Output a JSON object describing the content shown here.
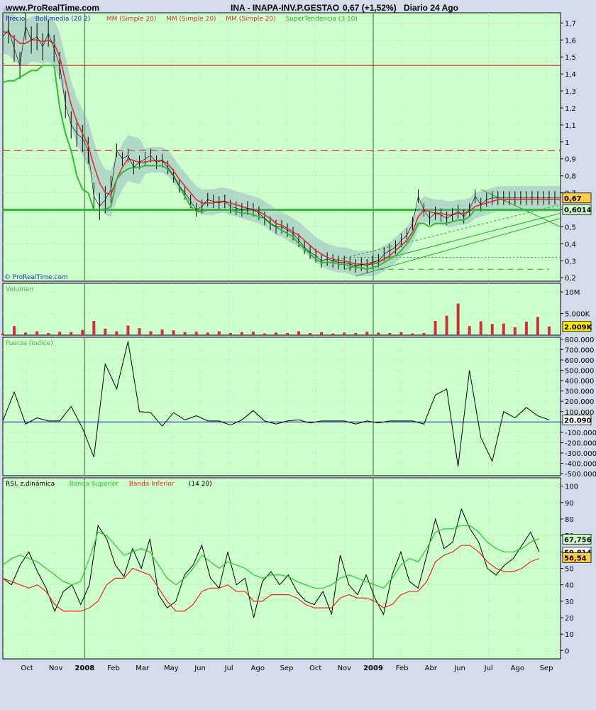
{
  "header": {
    "site": "www.ProRealTime.com",
    "title": "INA - INAPA-INV.P.GESTAO",
    "quote": "0,67 (+1,52%)",
    "period": "Diario  24 Ago"
  },
  "watermark": "© ProRealTime.com",
  "colors": {
    "bg": "#ccffcc",
    "price": "#000000",
    "mm": "#e03030",
    "boll": "#8090c0",
    "supertrend": "#33bb33",
    "vol": "#cc3333",
    "rsi_upper": "#22cc22",
    "rsi_lower": "#ee2222"
  },
  "chart_data": [
    {
      "type": "line",
      "name": "price-panel",
      "legend": [
        "Precio",
        "Boll media (20 2)",
        "MM (Simple 20)",
        "MM (Simple 20)",
        "MM (Simple 20)",
        "SuperTendencia (3 10)"
      ],
      "legend_colors": [
        "#2222cc",
        "#2222cc",
        "#cc3333",
        "#cc3333",
        "#cc3333",
        "#33aa33"
      ],
      "ylim": [
        0.18,
        1.76
      ],
      "yticks": [
        "1,7",
        "1,6",
        "1,5",
        "1,4",
        "1,3",
        "1,2",
        "1,1",
        "1",
        "0,9",
        "0,8",
        "0,7",
        "0,6",
        "0,5",
        "0,4",
        "0,3",
        "0,2"
      ],
      "ytick_values": [
        1.7,
        1.6,
        1.5,
        1.4,
        1.3,
        1.2,
        1.1,
        1.0,
        0.9,
        0.8,
        0.7,
        0.6,
        0.5,
        0.4,
        0.3,
        0.2
      ],
      "markers": [
        {
          "text": "0,67",
          "value": 0.67,
          "style": "orange"
        },
        {
          "text": "0,6014",
          "value": 0.6014,
          "style": "green"
        }
      ],
      "hlines": [
        {
          "y": 1.45,
          "color": "#dd2222",
          "dash": ""
        },
        {
          "y": 0.95,
          "color": "#dd2222",
          "dash": "10,6"
        },
        {
          "y": 0.6,
          "color": "#33bb33",
          "dash": "",
          "width": 3
        }
      ],
      "x": [
        0,
        5,
        10,
        15,
        20,
        25,
        30,
        35,
        40,
        45,
        50,
        55,
        60,
        65,
        70,
        75,
        80,
        85,
        90,
        95,
        100,
        105,
        110,
        115,
        120,
        125,
        130,
        135,
        140,
        145,
        150,
        155,
        160,
        165,
        170,
        175,
        180,
        185,
        190,
        195,
        200,
        205,
        210,
        215,
        220,
        225,
        230,
        235,
        240,
        245,
        250,
        255,
        260,
        265,
        270,
        275,
        280,
        285,
        290,
        295,
        300,
        305,
        310,
        315,
        320,
        325,
        330,
        335,
        340,
        345,
        350,
        355,
        360,
        365,
        370,
        375,
        380,
        385,
        390,
        395,
        400,
        405,
        410,
        415,
        420,
        425,
        430,
        435,
        440,
        445,
        450,
        455,
        460,
        465,
        470,
        475,
        480,
        485,
        490
      ],
      "series": [
        {
          "name": "Precio",
          "values": [
            1.62,
            1.66,
            1.55,
            1.45,
            1.68,
            1.6,
            1.62,
            1.56,
            1.64,
            1.55,
            1.45,
            1.22,
            1.1,
            1.05,
            1.02,
            0.95,
            0.68,
            0.62,
            0.66,
            0.72,
            0.95,
            0.9,
            0.92,
            0.85,
            0.88,
            0.9,
            0.92,
            0.88,
            0.89,
            0.85,
            0.8,
            0.74,
            0.7,
            0.65,
            0.6,
            0.62,
            0.66,
            0.65,
            0.64,
            0.65,
            0.62,
            0.61,
            0.6,
            0.61,
            0.6,
            0.58,
            0.55,
            0.52,
            0.5,
            0.5,
            0.48,
            0.46,
            0.42,
            0.38,
            0.35,
            0.33,
            0.3,
            0.31,
            0.3,
            0.29,
            0.29,
            0.28,
            0.27,
            0.28,
            0.27,
            0.29,
            0.3,
            0.34,
            0.36,
            0.38,
            0.42,
            0.45,
            0.52,
            0.68,
            0.6,
            0.55,
            0.58,
            0.57,
            0.55,
            0.57,
            0.59,
            0.56,
            0.6,
            0.68,
            0.63,
            0.66,
            0.67,
            0.67,
            0.67,
            0.67,
            0.67,
            0.67,
            0.67,
            0.67,
            0.67,
            0.67,
            0.67,
            0.67,
            0.67
          ]
        },
        {
          "name": "MM (Simple 20)",
          "values": [
            1.65,
            1.64,
            1.61,
            1.58,
            1.58,
            1.6,
            1.6,
            1.59,
            1.6,
            1.58,
            1.5,
            1.36,
            1.22,
            1.12,
            1.05,
            0.98,
            0.86,
            0.76,
            0.7,
            0.69,
            0.78,
            0.85,
            0.9,
            0.89,
            0.88,
            0.88,
            0.89,
            0.89,
            0.89,
            0.87,
            0.83,
            0.78,
            0.74,
            0.7,
            0.66,
            0.64,
            0.64,
            0.64,
            0.65,
            0.65,
            0.64,
            0.63,
            0.62,
            0.61,
            0.6,
            0.59,
            0.57,
            0.55,
            0.52,
            0.51,
            0.49,
            0.47,
            0.45,
            0.42,
            0.39,
            0.36,
            0.34,
            0.32,
            0.31,
            0.3,
            0.3,
            0.29,
            0.28,
            0.28,
            0.28,
            0.28,
            0.29,
            0.31,
            0.33,
            0.36,
            0.39,
            0.42,
            0.47,
            0.56,
            0.6,
            0.59,
            0.58,
            0.58,
            0.57,
            0.57,
            0.58,
            0.58,
            0.59,
            0.62,
            0.63,
            0.64,
            0.65,
            0.66,
            0.66,
            0.66,
            0.66,
            0.66,
            0.66,
            0.66,
            0.66,
            0.66,
            0.66,
            0.66,
            0.66
          ]
        },
        {
          "name": "SuperTendencia (3 10)",
          "values": [
            1.35,
            1.36,
            1.36,
            1.38,
            1.4,
            1.42,
            1.42,
            1.45,
            1.45,
            1.45,
            1.2,
            1.05,
            0.95,
            0.8,
            0.72,
            0.7,
            0.6,
            0.6,
            0.6,
            0.62,
            0.78,
            0.82,
            0.84,
            0.85,
            0.85,
            0.86,
            0.86,
            0.86,
            0.86,
            0.84,
            0.8,
            0.74,
            0.68,
            0.62,
            0.59,
            0.59,
            0.6,
            0.6,
            0.6,
            0.6,
            0.6,
            0.59,
            0.58,
            0.58,
            0.57,
            0.56,
            0.55,
            0.52,
            0.5,
            0.48,
            0.46,
            0.44,
            0.4,
            0.37,
            0.34,
            0.31,
            0.29,
            0.29,
            0.29,
            0.28,
            0.28,
            0.27,
            0.26,
            0.26,
            0.25,
            0.26,
            0.27,
            0.29,
            0.31,
            0.33,
            0.36,
            0.4,
            0.45,
            0.52,
            0.52,
            0.5,
            0.52,
            0.52,
            0.52,
            0.53,
            0.54,
            0.54,
            0.56,
            0.6,
            0.6,
            0.6,
            0.6,
            0.6,
            0.6,
            0.6,
            0.6,
            0.6,
            0.6,
            0.6,
            0.6,
            0.6,
            0.6,
            0.6,
            0.6
          ]
        }
      ]
    },
    {
      "type": "bar",
      "name": "volume-panel",
      "legend": [
        "Volumen"
      ],
      "ylim": [
        0,
        12000000
      ],
      "yticks": [
        "10M",
        "5.000K"
      ],
      "ytick_values": [
        10000000,
        5000000
      ],
      "markers": [
        {
          "text": "2.009K",
          "value": 2009000,
          "style": "yellow"
        }
      ],
      "x": [
        0,
        10,
        20,
        30,
        40,
        50,
        60,
        70,
        80,
        90,
        100,
        110,
        120,
        130,
        140,
        150,
        160,
        170,
        180,
        190,
        200,
        210,
        220,
        230,
        240,
        250,
        260,
        270,
        280,
        290,
        300,
        310,
        320,
        330,
        340,
        350,
        360,
        370,
        380,
        390,
        400,
        410,
        420,
        430,
        440,
        450,
        460,
        470,
        480
      ],
      "values": [
        400000,
        2100000,
        600000,
        900000,
        500000,
        800000,
        700000,
        1200000,
        3300000,
        1500000,
        900000,
        2200000,
        1600000,
        900000,
        1300000,
        1100000,
        700000,
        800000,
        600000,
        900000,
        500000,
        700000,
        800000,
        400000,
        600000,
        500000,
        900000,
        500000,
        700000,
        400000,
        600000,
        500000,
        800000,
        600000,
        500000,
        700000,
        400000,
        500000,
        3300000,
        4500000,
        7300000,
        2100000,
        3200000,
        2600000,
        2700000,
        1800000,
        3100000,
        4200000,
        2009000
      ]
    },
    {
      "type": "bar",
      "name": "fuerza-panel",
      "legend": [
        "Fuerza (índice)"
      ],
      "ylim": [
        -520000,
        820000
      ],
      "yticks": [
        "800.000",
        "700.000",
        "600.000",
        "500.000",
        "400.000",
        "300.000",
        "200.000",
        "100.000",
        "0",
        "-100.000",
        "-200.000",
        "-300.000",
        "-400.000",
        "-500.000"
      ],
      "ytick_values": [
        800000,
        700000,
        600000,
        500000,
        400000,
        300000,
        200000,
        100000,
        0,
        -100000,
        -200000,
        -300000,
        -400000,
        -500000
      ],
      "markers": [
        {
          "text": "20.090",
          "value": 20090,
          "style": "white"
        }
      ],
      "x": [
        0,
        10,
        20,
        30,
        40,
        50,
        60,
        70,
        80,
        90,
        100,
        110,
        120,
        130,
        140,
        150,
        160,
        170,
        180,
        190,
        200,
        210,
        220,
        230,
        240,
        250,
        260,
        270,
        280,
        290,
        300,
        310,
        320,
        330,
        340,
        350,
        360,
        370,
        380,
        390,
        400,
        410,
        420,
        430,
        440,
        450,
        460,
        470,
        480
      ],
      "values": [
        10000,
        290000,
        -20000,
        40000,
        10000,
        10000,
        150000,
        -60000,
        -340000,
        560000,
        320000,
        780000,
        100000,
        90000,
        -40000,
        90000,
        20000,
        60000,
        10000,
        10000,
        -30000,
        20000,
        110000,
        10000,
        -20000,
        10000,
        20000,
        -10000,
        10000,
        10000,
        10000,
        -20000,
        10000,
        -10000,
        10000,
        10000,
        10000,
        -20000,
        260000,
        320000,
        -430000,
        500000,
        -150000,
        -380000,
        100000,
        40000,
        140000,
        60000,
        20090
      ]
    },
    {
      "type": "line",
      "name": "rsi-panel",
      "legend": [
        "RSI, z.dinámica",
        "Banda Superior",
        "Banda Inferior",
        "(14 20)"
      ],
      "legend_colors": [
        "#000000",
        "#22cc22",
        "#ee2222",
        "#000000"
      ],
      "ylim": [
        -5,
        105
      ],
      "yticks": [
        "100",
        "90",
        "80",
        "70",
        "60",
        "50",
        "40",
        "30",
        "20",
        "10",
        "0"
      ],
      "ytick_values": [
        100,
        90,
        80,
        70,
        60,
        50,
        40,
        30,
        20,
        10,
        0
      ],
      "markers": [
        {
          "text": "67,756",
          "value": 67.756,
          "style": "green"
        },
        {
          "text": "59,814",
          "value": 59.814,
          "style": "white"
        },
        {
          "text": "56,54",
          "value": 56.54,
          "style": "orange"
        }
      ],
      "x": [
        0,
        10,
        20,
        30,
        40,
        50,
        60,
        70,
        80,
        90,
        100,
        110,
        120,
        130,
        140,
        150,
        160,
        170,
        180,
        190,
        200,
        210,
        220,
        230,
        240,
        250,
        260,
        270,
        280,
        290,
        300,
        310,
        320,
        330,
        340,
        350,
        360,
        370,
        380,
        390,
        400,
        410,
        420,
        430,
        440,
        450,
        460,
        470,
        480
      ],
      "series": [
        {
          "name": "RSI",
          "values": [
            44,
            40,
            52,
            60,
            48,
            38,
            24,
            36,
            40,
            28,
            40,
            76,
            68,
            52,
            45,
            62,
            50,
            68,
            34,
            26,
            30,
            46,
            52,
            64,
            44,
            38,
            60,
            40,
            44,
            20,
            42,
            48,
            40,
            46,
            36,
            30,
            28,
            36,
            22,
            58,
            40,
            34,
            46,
            32,
            22,
            46,
            60,
            42,
            38,
            58,
            80,
            62,
            66,
            86,
            74,
            66,
            50,
            46,
            52,
            56,
            64,
            72,
            60
          ]
        },
        {
          "name": "Banda Superior",
          "values": [
            52,
            56,
            58,
            56,
            54,
            50,
            46,
            42,
            40,
            42,
            56,
            72,
            70,
            64,
            58,
            60,
            62,
            60,
            52,
            44,
            40,
            44,
            50,
            58,
            54,
            50,
            54,
            52,
            50,
            46,
            44,
            46,
            46,
            45,
            42,
            40,
            38,
            38,
            40,
            44,
            46,
            44,
            42,
            40,
            38,
            44,
            52,
            56,
            54,
            62,
            72,
            74,
            74,
            76,
            76,
            72,
            66,
            62,
            60,
            60,
            62,
            66,
            68
          ]
        },
        {
          "name": "Banda Inferior",
          "values": [
            44,
            42,
            40,
            38,
            40,
            36,
            28,
            24,
            24,
            24,
            26,
            30,
            40,
            44,
            44,
            50,
            48,
            46,
            38,
            30,
            24,
            24,
            28,
            36,
            38,
            38,
            40,
            36,
            36,
            30,
            30,
            34,
            34,
            34,
            32,
            28,
            26,
            26,
            26,
            32,
            34,
            32,
            32,
            30,
            26,
            28,
            34,
            36,
            36,
            42,
            54,
            58,
            60,
            64,
            64,
            60,
            54,
            50,
            48,
            48,
            50,
            54,
            56
          ]
        }
      ]
    }
  ],
  "xaxis": {
    "labels": [
      "Oct",
      "Nov",
      "2008",
      "Feb",
      "Mar",
      "May",
      "Jun",
      "Jul",
      "Ago",
      "Sep",
      "Oct",
      "Nov",
      "2009",
      "Feb",
      "Abr",
      "Jun",
      "Jul",
      "Ago",
      "Sep"
    ],
    "bold": [
      "2008",
      "2009"
    ]
  }
}
